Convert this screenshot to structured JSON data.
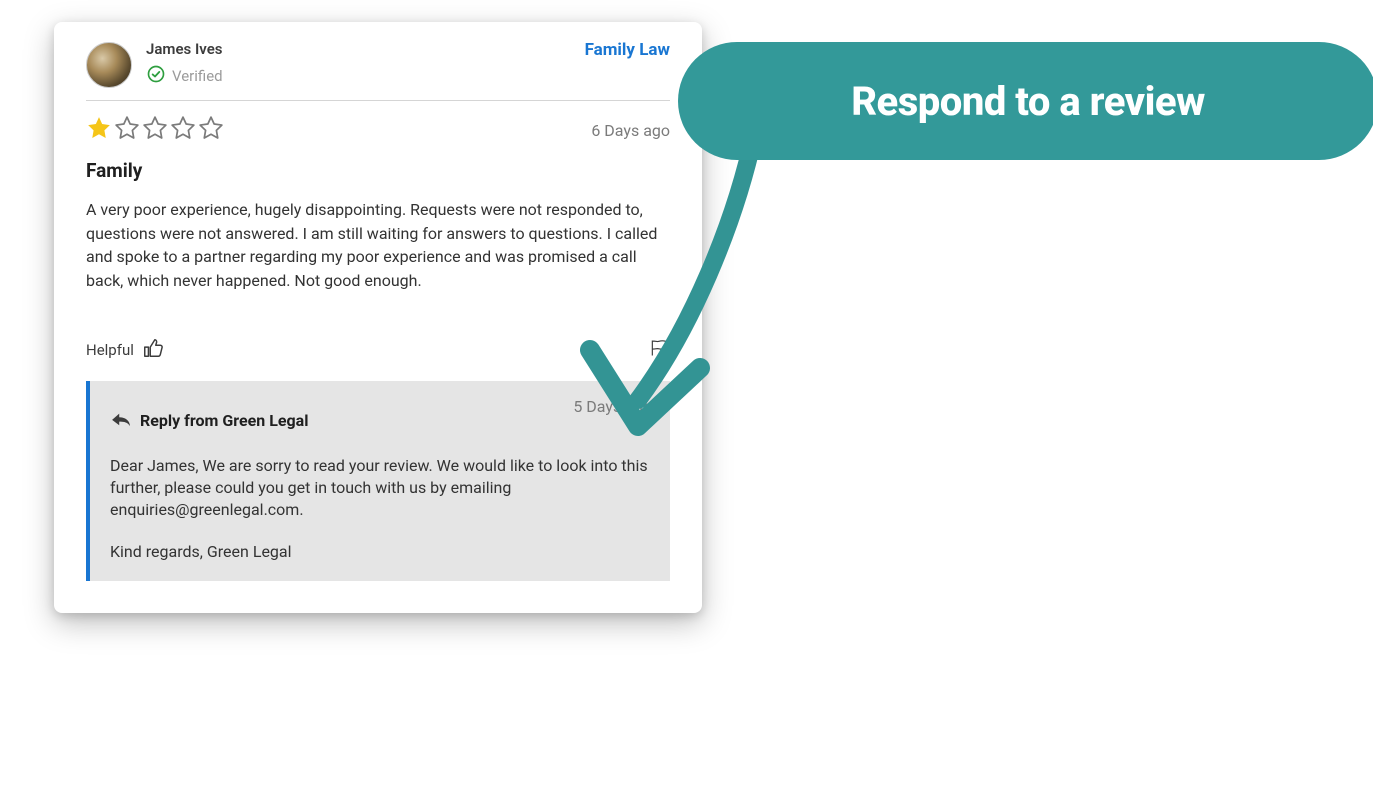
{
  "callout": {
    "text": "Respond to a review"
  },
  "review": {
    "reviewer_name": "James Ives",
    "verified_label": "Verified",
    "category": "Family Law",
    "rating": 1,
    "max_rating": 5,
    "timestamp": "6 Days ago",
    "title": "Family",
    "body": "A very poor experience, hugely disappointing. Requests were not responded to, questions were not answered. I am still waiting for answers to questions. I called and spoke to a partner regarding my poor experience and was promised a call back, which never happened. Not good enough.",
    "helpful_label": "Helpful"
  },
  "reply": {
    "from_label": "Reply from Green Legal",
    "timestamp": "5 Days ago",
    "body": "Dear James, We are sorry to read your review. We would like to look into this further, please could you get in touch with us by emailing enquiries@greenlegal.com.",
    "signoff": "Kind regards, Green Legal"
  }
}
